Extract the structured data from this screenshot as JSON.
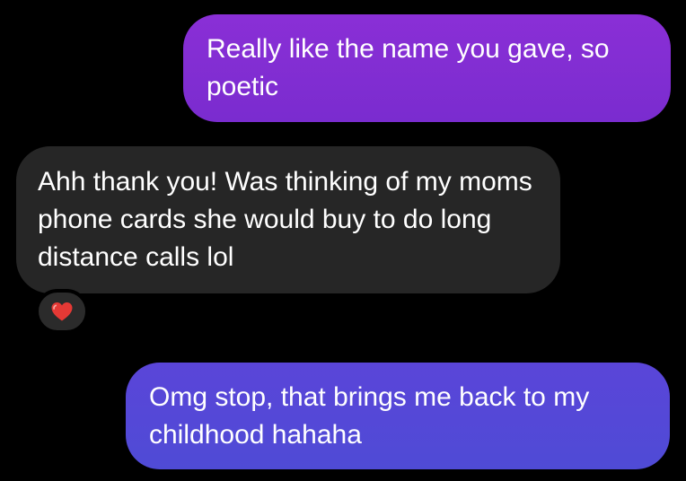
{
  "colors": {
    "background": "#000000",
    "outgoing_bubble_1": "#812DD3",
    "incoming_bubble": "#262626",
    "outgoing_bubble_2": "#5548D7",
    "reaction_heart": "#E53935",
    "text": "#FFFFFF"
  },
  "messages": [
    {
      "direction": "outgoing",
      "text": "Really like the name you gave, so poetic"
    },
    {
      "direction": "incoming",
      "text": "Ahh thank you! Was thinking of my moms phone cards she would buy to do long distance calls lol",
      "reaction": {
        "icon": "red-heart-icon"
      }
    },
    {
      "direction": "outgoing",
      "text": "Omg stop, that brings me back to my childhood hahaha"
    }
  ]
}
